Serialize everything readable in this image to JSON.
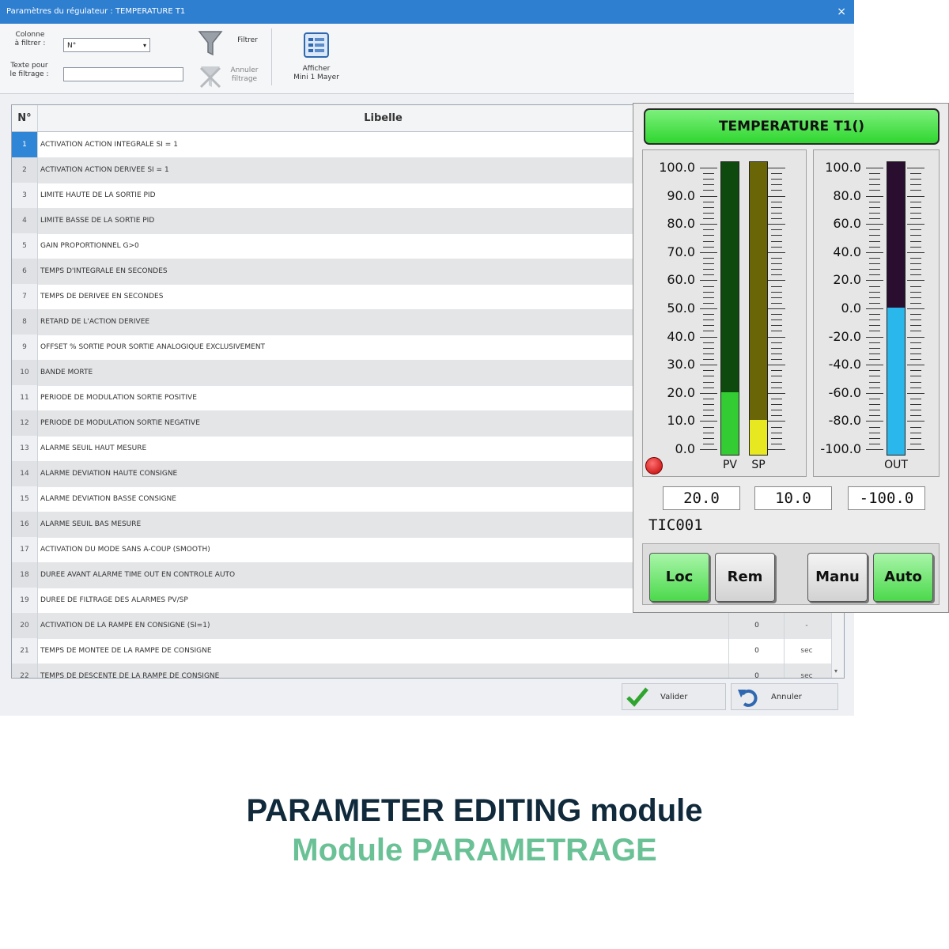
{
  "window": {
    "title": "Paramètres du régulateur : TEMPERATURE T1",
    "close_glyph": "×"
  },
  "toolbar": {
    "filter_column_label": "Colonne\nà filtrer :",
    "filter_column_value": "N°",
    "filter_text_label": "Texte pour\nle filtrage :",
    "filter_text_value": "",
    "filter_button": "Filtrer",
    "cancel_filter_button": "Annuler\nfiltrage",
    "show_button": "Afficher\nMini 1 Mayer"
  },
  "grid": {
    "headers": {
      "num": "N°",
      "label": "Libelle"
    },
    "rows": [
      {
        "num": "1",
        "label": "ACTIVATION ACTION INTEGRALE SI = 1",
        "value": "",
        "unit": ""
      },
      {
        "num": "2",
        "label": "ACTIVATION ACTION DERIVEE SI = 1",
        "value": "",
        "unit": ""
      },
      {
        "num": "3",
        "label": "LIMITE HAUTE DE LA SORTIE PID",
        "value": "",
        "unit": ""
      },
      {
        "num": "4",
        "label": "LIMITE BASSE DE LA SORTIE PID",
        "value": "",
        "unit": ""
      },
      {
        "num": "5",
        "label": "GAIN PROPORTIONNEL G>0",
        "value": "",
        "unit": ""
      },
      {
        "num": "6",
        "label": "TEMPS D'INTEGRALE EN SECONDES",
        "value": "",
        "unit": ""
      },
      {
        "num": "7",
        "label": "TEMPS DE DERIVEE EN SECONDES",
        "value": "",
        "unit": ""
      },
      {
        "num": "8",
        "label": "RETARD DE L'ACTION DERIVEE",
        "value": "",
        "unit": ""
      },
      {
        "num": "9",
        "label": "OFFSET % SORTIE POUR SORTIE ANALOGIQUE EXCLUSIVEMENT",
        "value": "",
        "unit": ""
      },
      {
        "num": "10",
        "label": "BANDE MORTE",
        "value": "",
        "unit": ""
      },
      {
        "num": "11",
        "label": "PERIODE DE MODULATION SORTIE POSITIVE",
        "value": "",
        "unit": ""
      },
      {
        "num": "12",
        "label": "PERIODE DE MODULATION SORTIE NEGATIVE",
        "value": "",
        "unit": ""
      },
      {
        "num": "13",
        "label": "ALARME SEUIL HAUT MESURE",
        "value": "",
        "unit": ""
      },
      {
        "num": "14",
        "label": "ALARME DEVIATION HAUTE CONSIGNE",
        "value": "",
        "unit": ""
      },
      {
        "num": "15",
        "label": "ALARME DEVIATION BASSE CONSIGNE",
        "value": "",
        "unit": ""
      },
      {
        "num": "16",
        "label": "ALARME SEUIL BAS MESURE",
        "value": "",
        "unit": ""
      },
      {
        "num": "17",
        "label": "ACTIVATION DU MODE SANS A-COUP (SMOOTH)",
        "value": "",
        "unit": ""
      },
      {
        "num": "18",
        "label": "DUREE AVANT ALARME TIME OUT EN CONTROLE AUTO",
        "value": "",
        "unit": ""
      },
      {
        "num": "19",
        "label": "DUREE DE FILTRAGE DES ALARMES PV/SP",
        "value": "",
        "unit": ""
      },
      {
        "num": "20",
        "label": "ACTIVATION DE LA RAMPE EN CONSIGNE (SI=1)",
        "value": "0",
        "unit": "-"
      },
      {
        "num": "21",
        "label": "TEMPS DE MONTEE DE LA RAMPE DE CONSIGNE",
        "value": "0",
        "unit": "sec"
      },
      {
        "num": "22",
        "label": "TEMPS DE DESCENTE DE LA RAMPE DE CONSIGNE",
        "value": "0",
        "unit": "sec"
      }
    ]
  },
  "footer": {
    "validate_button": "Valider",
    "cancel_button": "Annuler"
  },
  "controller": {
    "title": "TEMPERATURE T1()",
    "left_scale": [
      "100.0",
      "90.0",
      "80.0",
      "70.0",
      "60.0",
      "50.0",
      "40.0",
      "30.0",
      "20.0",
      "10.0",
      "0.0"
    ],
    "right_scale": [
      "100.0",
      "80.0",
      "60.0",
      "40.0",
      "20.0",
      "0.0",
      "-20.0",
      "-40.0",
      "-60.0",
      "-80.0",
      "-100.0"
    ],
    "pv_label": "PV",
    "sp_label": "SP",
    "out_label": "OUT",
    "pv_value": 20.0,
    "sp_value": 10.0,
    "out_value": -100.0,
    "pv_display": "20.0",
    "sp_display": "10.0",
    "out_display": "-100.0",
    "tag": "TIC001",
    "buttons": {
      "loc": "Loc",
      "rem": "Rem",
      "manu": "Manu",
      "auto": "Auto"
    },
    "colors": {
      "pv": "#33cc33",
      "pv_bg": "#0e4a0e",
      "sp": "#e8e820",
      "sp_bg": "#6a6608",
      "out": "#2ab8ec",
      "out_bg": "#2a0e30",
      "title": "#33dd33",
      "alarm": "#dd1111"
    }
  },
  "caption": {
    "line1": "PARAMETER EDITING module",
    "line2": "Module PARAMETRAGE"
  }
}
